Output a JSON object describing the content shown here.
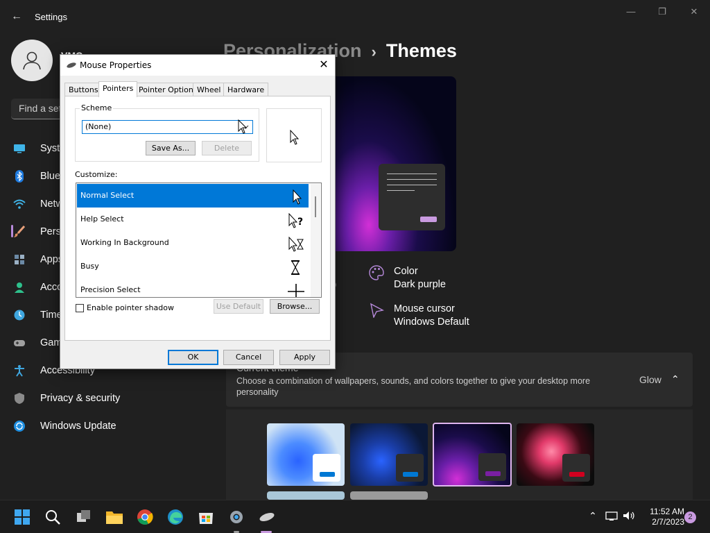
{
  "window": {
    "app_title": "Settings",
    "back_glyph": "←",
    "minimize_glyph": "—",
    "maximize_glyph": "❐",
    "close_glyph": "✕"
  },
  "user": {
    "name": "VMC"
  },
  "search": {
    "placeholder": "Find a setting"
  },
  "sidebar": {
    "items": [
      {
        "label": "System",
        "icon": "monitor-icon"
      },
      {
        "label": "Bluetooth & devices",
        "icon": "bluetooth-icon"
      },
      {
        "label": "Network & internet",
        "icon": "wifi-icon"
      },
      {
        "label": "Personalization",
        "icon": "paintbrush-icon"
      },
      {
        "label": "Apps",
        "icon": "apps-icon"
      },
      {
        "label": "Accounts",
        "icon": "person-icon"
      },
      {
        "label": "Time & language",
        "icon": "clock-globe-icon"
      },
      {
        "label": "Gaming",
        "icon": "gamepad-icon"
      },
      {
        "label": "Accessibility",
        "icon": "accessibility-icon"
      },
      {
        "label": "Privacy & security",
        "icon": "shield-icon"
      },
      {
        "label": "Windows Update",
        "icon": "update-icon"
      }
    ]
  },
  "breadcrumb": {
    "parent": "Personalization",
    "separator": "›",
    "current": "Themes"
  },
  "theme_info": {
    "sliver_text": ")",
    "color": {
      "title": "Color",
      "value": "Dark purple"
    },
    "cursor": {
      "title": "Mouse cursor",
      "value": "Windows Default"
    }
  },
  "current_theme": {
    "title": "Current theme",
    "description": "Choose a combination of wallpapers, sounds, and colors together to give your desktop more personality",
    "value": "Glow",
    "chevron": "⌃"
  },
  "themes": [
    {
      "name": "windows-light",
      "accent": "#0078d4",
      "selected": false
    },
    {
      "name": "windows-dark",
      "accent": "#0078d4",
      "selected": false
    },
    {
      "name": "glow",
      "accent": "#7a1fa2",
      "selected": true
    },
    {
      "name": "captured-motion",
      "accent": "#d1001f",
      "selected": false
    }
  ],
  "taskbar": {
    "time": "11:52 AM",
    "date": "2/7/2023",
    "notification_count": "2",
    "tray_chevron": "⌃"
  },
  "dialog": {
    "title": "Mouse Properties",
    "close_glyph": "✕",
    "tabs": [
      "Buttons",
      "Pointers",
      "Pointer Options",
      "Wheel",
      "Hardware"
    ],
    "active_tab": "Pointers",
    "scheme": {
      "group_label": "Scheme",
      "selected": "(None)",
      "save_as": "Save As...",
      "delete": "Delete"
    },
    "customize": {
      "label": "Customize:",
      "rows": [
        {
          "label": "Normal Select",
          "cursor_icon": "arrow-cursor-icon",
          "selected": true
        },
        {
          "label": "Help Select",
          "cursor_icon": "help-cursor-icon",
          "selected": false
        },
        {
          "label": "Working In Background",
          "cursor_icon": "working-cursor-icon",
          "selected": false
        },
        {
          "label": "Busy",
          "cursor_icon": "hourglass-cursor-icon",
          "selected": false
        },
        {
          "label": "Precision Select",
          "cursor_icon": "crosshair-cursor-icon",
          "selected": false
        }
      ]
    },
    "shadow_label": "Enable pointer shadow",
    "shadow_checked": false,
    "use_default": "Use Default",
    "browse": "Browse...",
    "ok": "OK",
    "cancel": "Cancel",
    "apply": "Apply",
    "help_glyph": "?"
  }
}
